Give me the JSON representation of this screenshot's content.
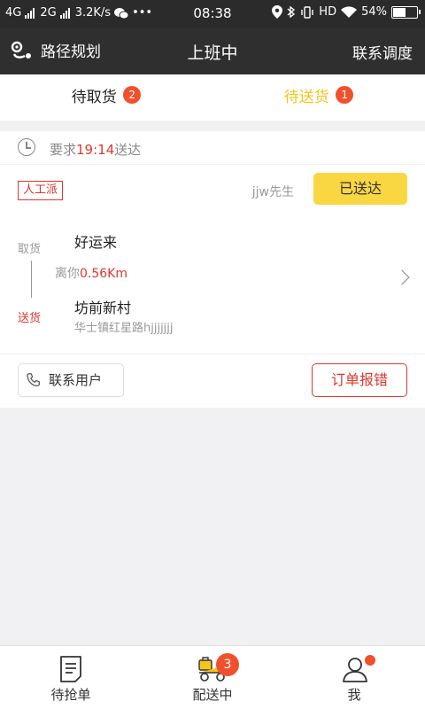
{
  "status_bar": {
    "net1": "4G",
    "net2": "2G",
    "speed": "3.2K/s",
    "more": "•••",
    "time": "08:38",
    "hd": "HD",
    "battery": "54%",
    "battery_level": 0.54
  },
  "header": {
    "route_label": "路径规划",
    "title": "上班中",
    "dispatch_label": "联系调度"
  },
  "tabs": [
    {
      "label": "待取货",
      "count": "2"
    },
    {
      "label": "待送货",
      "count": "1"
    }
  ],
  "order": {
    "requirement_prefix": "要求",
    "requirement_time": "19:14",
    "requirement_suffix": "送达",
    "tag": "人工派",
    "customer": "jjw先生",
    "delivered_button": "已送达",
    "pickup_label": "取货",
    "pickup_name": "好运来",
    "distance_prefix": "离你",
    "distance_value": "0.56Km",
    "delivery_label": "送货",
    "delivery_name": "坊前新村",
    "delivery_address": "华士镇红星路hjjjjjjj",
    "contact_button": "联系用户",
    "report_button": "订单报错"
  },
  "bottom_nav": [
    {
      "label": "待抢单",
      "icon": "order-list-icon"
    },
    {
      "label": "配送中",
      "icon": "scooter-icon",
      "badge": "3"
    },
    {
      "label": "我",
      "icon": "user-icon"
    }
  ],
  "colors": {
    "accent_yellow": "#f9d742",
    "active_tab": "#f5c518",
    "red": "#e0362f",
    "badge": "#f0502c",
    "header_bg": "#2f2f2f"
  }
}
